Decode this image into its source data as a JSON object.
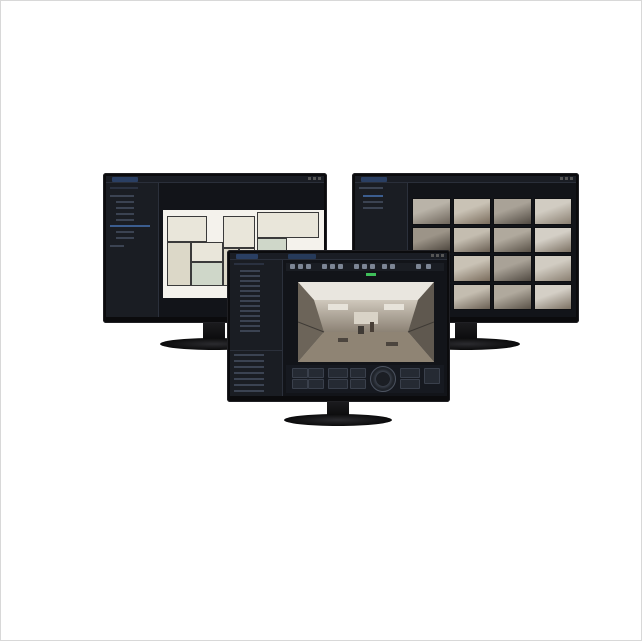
{
  "scene": {
    "description_text": ""
  },
  "monitors": {
    "left": {
      "window_tab": "",
      "tree_items": [
        "",
        "",
        "",
        "",
        "",
        "",
        "",
        ""
      ],
      "content": "floor-plan-map"
    },
    "right": {
      "window_tab": "",
      "tree_items": [
        "",
        "",
        "",
        ""
      ],
      "content": "camera-grid",
      "camera_tiles": 16
    },
    "front": {
      "window_tab": "",
      "tree_items": [
        "",
        "",
        "",
        "",
        "",
        "",
        "",
        "",
        "",
        "",
        "",
        "",
        "",
        "",
        "",
        ""
      ],
      "content": "live-camera-view",
      "ptz_dial": "ptz-control-dial-icon"
    }
  },
  "colors": {
    "bezel": "#0b0b0d",
    "screen_bg": "#121419",
    "accent_blue": "#3b5d8f",
    "status_green": "#3fbf5a",
    "floor_plan_bg": "#f4f2ec"
  }
}
